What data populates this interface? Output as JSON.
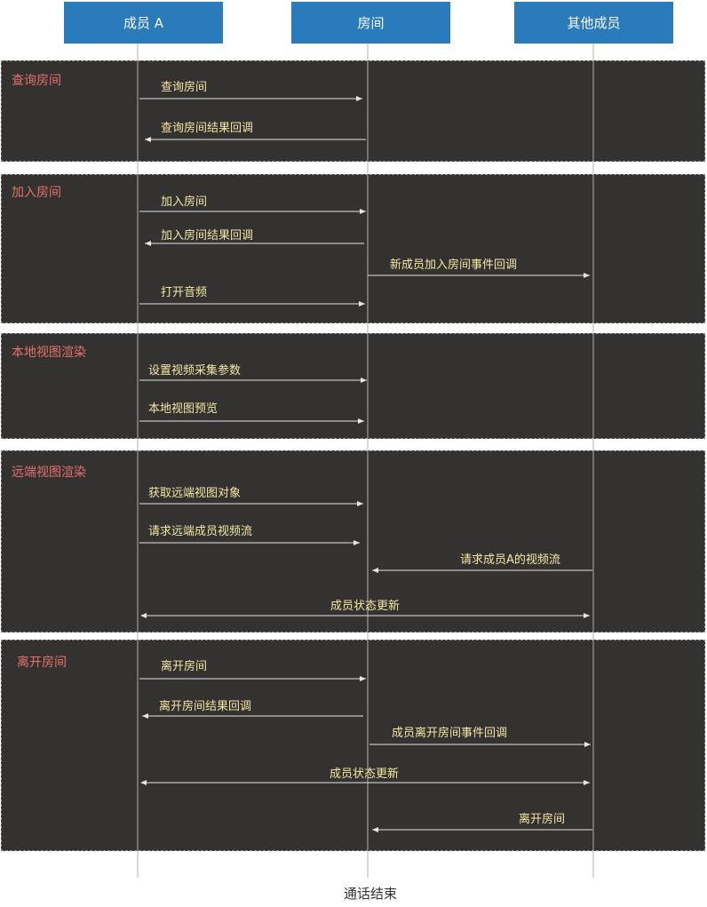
{
  "participants": [
    {
      "id": "a",
      "label": "成员 A"
    },
    {
      "id": "room",
      "label": "房间"
    },
    {
      "id": "others",
      "label": "其他成员"
    }
  ],
  "groups": [
    {
      "title": "查询房间",
      "messages": [
        {
          "text": "查询房间",
          "from": "a",
          "to": "room"
        },
        {
          "text": "查询房间结果回调",
          "from": "room",
          "to": "a"
        }
      ]
    },
    {
      "title": "加入房间",
      "messages": [
        {
          "text": "加入房间",
          "from": "a",
          "to": "room"
        },
        {
          "text": "加入房间结果回调",
          "from": "room",
          "to": "a"
        },
        {
          "text": "新成员加入房间事件回调",
          "from": "room",
          "to": "others"
        },
        {
          "text": "打开音频",
          "from": "a",
          "to": "room"
        }
      ]
    },
    {
      "title": "本地视图渲染",
      "messages": [
        {
          "text": "设置视频采集参数",
          "from": "a",
          "to": "room"
        },
        {
          "text": "本地视图预览",
          "from": "a",
          "to": "room"
        }
      ]
    },
    {
      "title": "远端视图渲染",
      "messages": [
        {
          "text": "获取远端视图对象",
          "from": "a",
          "to": "room"
        },
        {
          "text": "请求远端成员视频流",
          "from": "a",
          "to": "room"
        },
        {
          "text": "请求成员A的视频流",
          "from": "others",
          "to": "room"
        },
        {
          "text": "成员状态更新",
          "from": "a",
          "to": "others",
          "bidirectional": true
        }
      ]
    },
    {
      "title": "离开房间",
      "messages": [
        {
          "text": "离开房间",
          "from": "a",
          "to": "room"
        },
        {
          "text": "离开房间结果回调",
          "from": "room",
          "to": "a"
        },
        {
          "text": "成员离开房间事件回调",
          "from": "room",
          "to": "others"
        },
        {
          "text": "成员状态更新",
          "from": "a",
          "to": "others",
          "bidirectional": true
        },
        {
          "text": "离开房间",
          "from": "others",
          "to": "room"
        }
      ]
    }
  ],
  "footer": "通话结束",
  "colors": {
    "participant_fill": "#2a7bbb",
    "group_fill": "#333230",
    "group_title": "#e8706a",
    "message_label": "#f4e7a4",
    "arrow": "#e6e6e6",
    "lifeline": "#b0b0b0"
  }
}
